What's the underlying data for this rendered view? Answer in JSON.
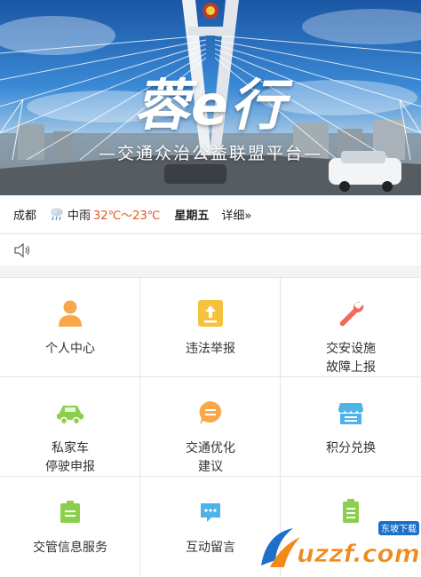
{
  "banner": {
    "title": "蓉e行",
    "subtitle": "—交通众治公益联盟平台—"
  },
  "weather": {
    "city": "成都",
    "icon": "rain-cloud-icon",
    "condition": "中雨",
    "temperature": "32℃～23℃",
    "weekday": "星期五",
    "detail_link": "详细»"
  },
  "notice": {
    "icon": "speaker-icon"
  },
  "colors": {
    "orange": "#f7a84a",
    "amber": "#f5c23e",
    "coral": "#f06a5a",
    "green": "#8ccf4e",
    "blue": "#4db3e8",
    "temp_red": "#e05a1e"
  },
  "grid": {
    "items": [
      {
        "icon": "person-icon",
        "lines": [
          "个人中心"
        ]
      },
      {
        "icon": "report-upload-icon",
        "lines": [
          "违法举报"
        ]
      },
      {
        "icon": "wrench-icon",
        "lines": [
          "交安设施",
          "故障上报"
        ]
      },
      {
        "icon": "car-icon",
        "lines": [
          "私家车",
          "停驶申报"
        ]
      },
      {
        "icon": "chat-bubble-icon",
        "lines": [
          "交通优化",
          "建议"
        ]
      },
      {
        "icon": "shop-icon",
        "lines": [
          "积分兑换"
        ]
      },
      {
        "icon": "info-box-icon",
        "lines": [
          "交管信息服务"
        ]
      },
      {
        "icon": "message-icon",
        "lines": [
          "互动留言"
        ]
      },
      {
        "icon": "clipboard-icon",
        "lines": []
      }
    ]
  },
  "watermark": {
    "logo_text": "uzzf.com",
    "tag_text": "东坡下载"
  }
}
